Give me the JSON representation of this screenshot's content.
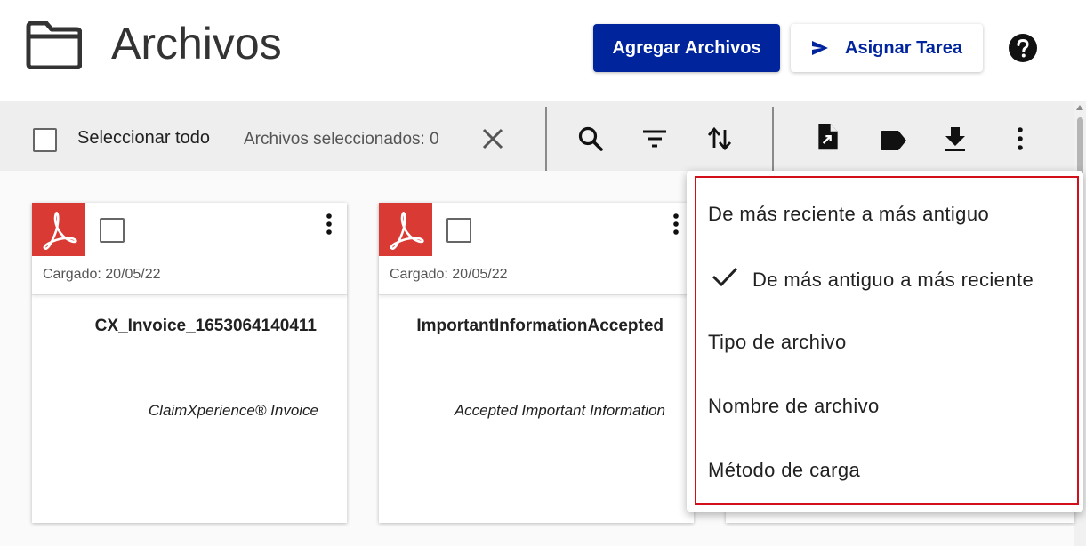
{
  "header": {
    "title": "Archivos",
    "add_files_label": "Agregar Archivos",
    "assign_task_label": "Asignar Tarea",
    "icons": [
      "folder-icon",
      "send-icon",
      "help-icon"
    ]
  },
  "toolbar": {
    "select_all_label": "Seleccionar todo",
    "selected_count_label": "Archivos seleccionados: 0",
    "icons": [
      "close-icon",
      "search-icon",
      "filter-icon",
      "sort-icon",
      "file-export-icon",
      "label-icon",
      "download-icon",
      "more-vert-icon"
    ]
  },
  "cards": [
    {
      "uploaded": "Cargado: 20/05/22",
      "name": "CX_Invoice_1653064140411",
      "description": "ClaimXperience® Invoice"
    },
    {
      "uploaded": "Cargado: 20/05/22",
      "name": "ImportantInformationAccepted",
      "description": "Accepted Important Information"
    }
  ],
  "sort_menu": {
    "items": [
      {
        "label": "De más reciente a más antiguo",
        "selected": false
      },
      {
        "label": "De más antiguo a más reciente",
        "selected": true
      },
      {
        "label": "Tipo de archivo",
        "selected": false
      },
      {
        "label": "Nombre de archivo",
        "selected": false
      },
      {
        "label": "Método de carga",
        "selected": false
      }
    ]
  },
  "colors": {
    "primary": "#00249c",
    "pdf_red": "#d93a34",
    "highlight_red": "#d3101a"
  }
}
